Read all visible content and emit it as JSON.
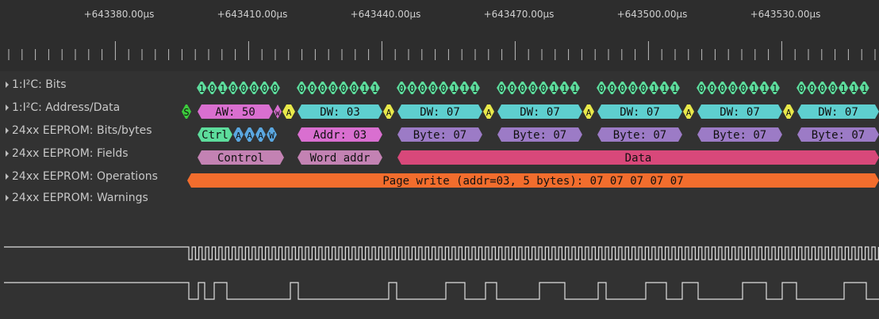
{
  "ruler": {
    "time_labels": [
      "+643380.00µs",
      "+643410.00µs",
      "+643440.00µs",
      "+643470.00µs",
      "+643500.00µs",
      "+643530.00µs"
    ]
  },
  "rows": [
    {
      "label": "1:I²C: Bits"
    },
    {
      "label": "1:I²C: Address/Data"
    },
    {
      "label": "24xx EEPROM: Bits/bytes"
    },
    {
      "label": "24xx EEPROM: Fields"
    },
    {
      "label": "24xx EEPROM: Operations"
    },
    {
      "label": "24xx EEPROM: Warnings"
    }
  ],
  "bits_groups": [
    {
      "bits": "10100000"
    },
    {
      "bits": "00000011"
    },
    {
      "bits": "00000111"
    },
    {
      "bits": "00000111"
    },
    {
      "bits": "00000111"
    },
    {
      "bits": "00000111"
    },
    {
      "bits": "0000111"
    }
  ],
  "addr_data": {
    "start": "S",
    "aw": "AW: 50",
    "w": "W",
    "ack": "A",
    "dw": [
      "DW: 03",
      "DW: 07",
      "DW: 07",
      "DW: 07",
      "DW: 07",
      "DW: 07"
    ]
  },
  "bits_bytes": {
    "ctrl": "Ctrl",
    "ctrl_bits": "A A A W",
    "addr": "Addr: 03",
    "bytes": [
      "Byte: 07",
      "Byte: 07",
      "Byte: 07",
      "Byte: 07",
      "Byte: 07"
    ]
  },
  "fields": {
    "control": "Control",
    "word_addr": "Word addr",
    "data": "Data"
  },
  "operations": {
    "text": "Page write (addr=03, 5 bytes): 07 07 07 07 07"
  },
  "colors": {
    "bits_green": "#5ddc9c",
    "aw_pink": "#d96fd0",
    "dw_cyan": "#5ecfcf",
    "ack_yellow": "#e8e84a",
    "start_green": "#3ccb3c",
    "ctrl_green": "#5ddc9c",
    "ctrl_bits_blue": "#5aa7e0",
    "byte_purple": "#9c7bc6",
    "fields_mauve": "#c382b3",
    "data_pink": "#d8487a",
    "op_orange": "#f26d2d"
  }
}
